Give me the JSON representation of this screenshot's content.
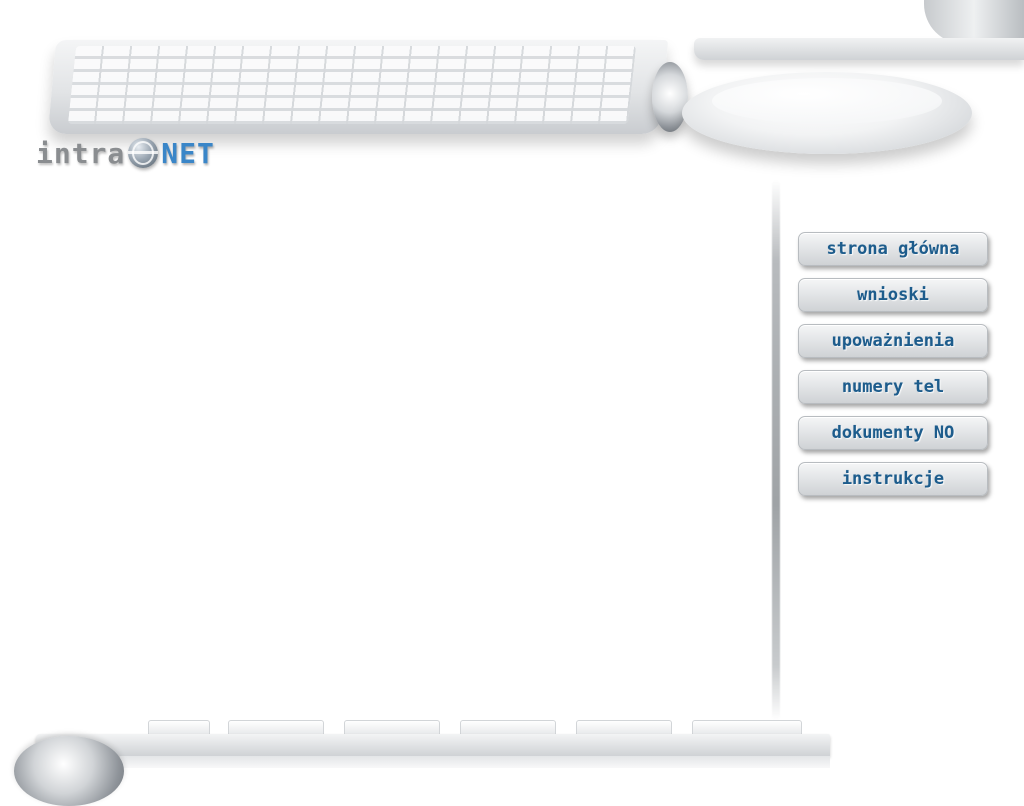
{
  "logo": {
    "part1": "intra",
    "part2": "NET"
  },
  "nav": {
    "items": [
      {
        "label": "strona główna"
      },
      {
        "label": "wnioski"
      },
      {
        "label": "upoważnienia"
      },
      {
        "label": "numery tel"
      },
      {
        "label": "dokumenty NO"
      },
      {
        "label": "instrukcje"
      }
    ]
  },
  "colors": {
    "nav_text": "#1d5c8c",
    "logo_net": "#3a86c8",
    "logo_intra": "#8a8d90"
  },
  "icons": {
    "logo_globe": "globe-icon"
  }
}
